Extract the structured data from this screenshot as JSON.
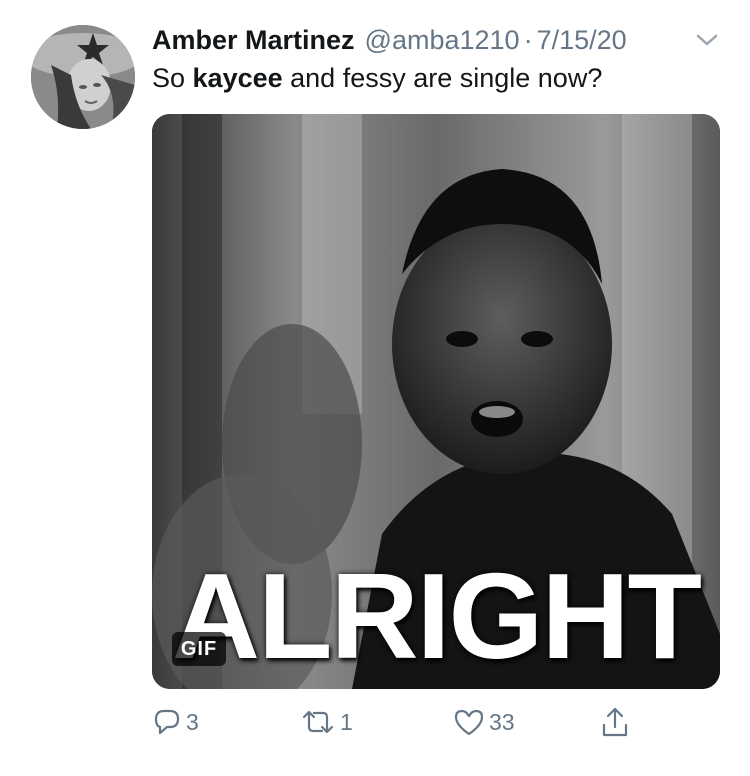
{
  "tweet": {
    "display_name": "Amber Martinez",
    "handle": "@amba1210",
    "separator": "·",
    "date": "7/15/20",
    "text_prefix": "So ",
    "text_bold": "kaycee",
    "text_suffix": " and fessy are single now?",
    "media": {
      "caption": "ALRIGHT",
      "badge": "GIF"
    },
    "actions": {
      "reply_count": "3",
      "retweet_count": "1",
      "like_count": "33"
    }
  },
  "icons": {
    "chevron": "chevron-down-icon",
    "reply": "reply-icon",
    "retweet": "retweet-icon",
    "like": "heart-icon",
    "share": "share-icon"
  },
  "colors": {
    "text": "#14171a",
    "secondary": "#657786"
  }
}
